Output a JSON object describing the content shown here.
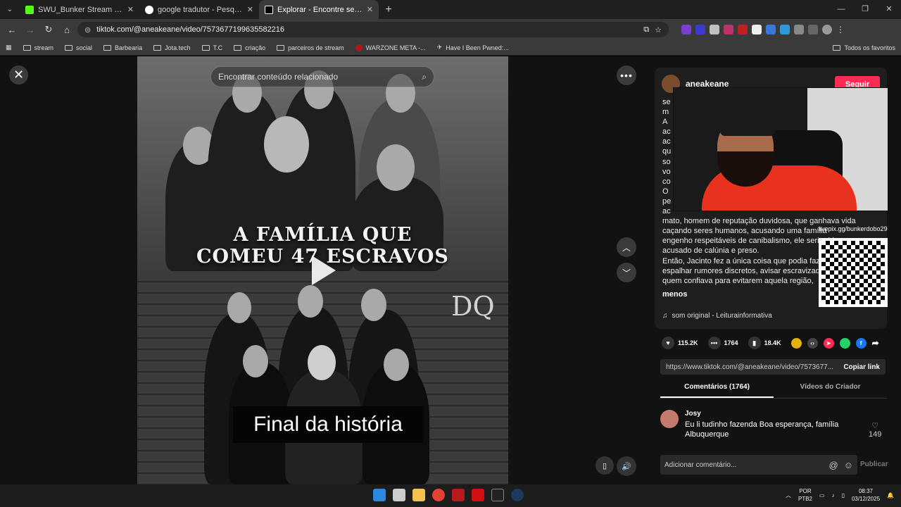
{
  "tabs": [
    {
      "title": "SWU_Bunker Stream - Watch L",
      "color": "#53fc18",
      "active": false
    },
    {
      "title": "google tradutor - Pesquisa Goo",
      "color": "#ffffff",
      "active": false
    },
    {
      "title": "Explorar - Encontre seus vídeos",
      "color": "#ffffff",
      "active": true
    }
  ],
  "url": "tiktok.com/@aneakeane/video/7573677199635582216",
  "bookmarks": [
    "stream",
    "social",
    "Barbearia",
    "Jota.tech",
    "T.C",
    "criação",
    "parceiros de stream",
    "WARZONE META -...",
    "Have I Been Pwned:..."
  ],
  "bookmarks_right": "Todos os favoritos",
  "video": {
    "search_placeholder": "Encontrar conteúdo relacionado",
    "title_line1": "A FAMÍLIA QUE",
    "title_line2": "COMEU 47 ESCRAVOS",
    "caption": "Final da história"
  },
  "panel": {
    "author": "aneakeane",
    "follow": "Seguir",
    "desc_lines": [
      "se",
      "m",
      "A",
      "ac",
      "ac",
      "qu",
      "so",
      "vo",
      "co",
      "O",
      "pe",
      "ac"
    ],
    "desc_full": [
      "mato, homem de reputação duvidosa, que ganhava vida",
      "caçando seres humanos, acusando uma família",
      "engenho respeitáveis de canibalismo, ele seria rido, ou",
      "acusado de calúnia e preso.",
      "Então, Jacinto fez a única coisa que podia fazer:",
      "espalhar rumores discretos, avisar escravizados",
      "quem confiava para evitarem aquela região,"
    ],
    "menos": "menos",
    "sound": "som original - Leiturainformativa",
    "likes": "115.2K",
    "comments": "1764",
    "saves": "18.4K",
    "link": "https://www.tiktok.com/@aneakeane/video/7573677...",
    "copy": "Copiar link",
    "tab_comments": "Comentários (1764)",
    "tab_videos": "Vídeos do Criador",
    "comment": {
      "name": "Josy",
      "text": "Eu li tudinho fazenda Boa esperança, família Albuquerque",
      "likes": "149"
    },
    "add_comment": "Adicionar comentário...",
    "publish": "Publicar"
  },
  "overlay": {
    "qr_label": "livepix.gg/bunkerdobo29"
  },
  "taskbar": {
    "lang": "POR",
    "layout": "PTB2",
    "time": "08:37",
    "date": "03/12/2025"
  }
}
